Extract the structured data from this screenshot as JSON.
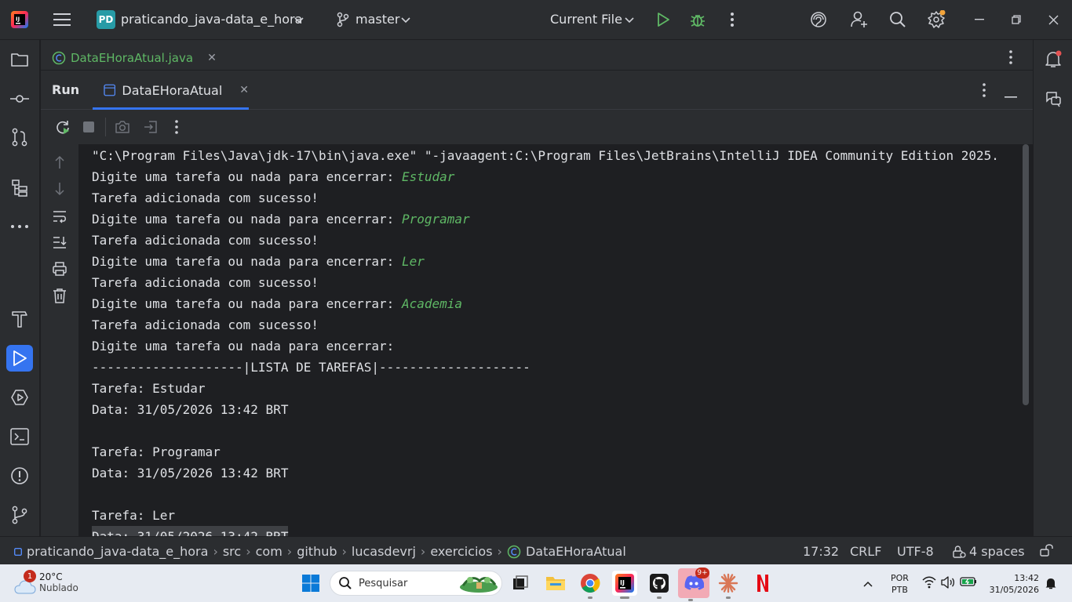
{
  "titlebar": {
    "project_badge": "PD",
    "project_name": "praticando_java-data_e_hora",
    "branch": "master",
    "run_config": "Current File"
  },
  "editor": {
    "tab_file": "DataEHoraAtual.java"
  },
  "run_panel": {
    "title": "Run",
    "tab_label": "DataEHoraAtual"
  },
  "console": {
    "lines": [
      {
        "text": "\"C:\\Program Files\\Java\\jdk-17\\bin\\java.exe\" \"-javaagent:C:\\Program Files\\JetBrains\\IntelliJ IDEA Community Edition 2025.",
        "input": ""
      },
      {
        "text": "Digite uma tarefa ou nada para encerrar: ",
        "input": "Estudar"
      },
      {
        "text": "Tarefa adicionada com sucesso!",
        "input": ""
      },
      {
        "text": "Digite uma tarefa ou nada para encerrar: ",
        "input": "Programar"
      },
      {
        "text": "Tarefa adicionada com sucesso!",
        "input": ""
      },
      {
        "text": "Digite uma tarefa ou nada para encerrar: ",
        "input": "Ler"
      },
      {
        "text": "Tarefa adicionada com sucesso!",
        "input": ""
      },
      {
        "text": "Digite uma tarefa ou nada para encerrar: ",
        "input": "Academia"
      },
      {
        "text": "Tarefa adicionada com sucesso!",
        "input": ""
      },
      {
        "text": "Digite uma tarefa ou nada para encerrar:",
        "input": ""
      },
      {
        "text": "--------------------|LISTA DE TAREFAS|--------------------",
        "input": ""
      },
      {
        "text": "Tarefa: Estudar",
        "input": ""
      },
      {
        "text": "Data: 31/05/2026 13:42 BRT",
        "input": ""
      },
      {
        "text": "",
        "input": ""
      },
      {
        "text": "Tarefa: Programar",
        "input": ""
      },
      {
        "text": "Data: 31/05/2026 13:42 BRT",
        "input": ""
      },
      {
        "text": "",
        "input": ""
      },
      {
        "text": "Tarefa: Ler",
        "input": ""
      },
      {
        "text": "Data: 31/05/2026 13:42 BRT",
        "input": ""
      }
    ]
  },
  "statusbar": {
    "breadcrumbs": [
      "praticando_java-data_e_hora",
      "src",
      "com",
      "github",
      "lucasdevrj",
      "exercicios",
      "DataEHoraAtual"
    ],
    "position": "17:32",
    "line_ending": "CRLF",
    "encoding": "UTF-8",
    "indent": "4 spaces"
  },
  "taskbar": {
    "weather_temp": "20°C",
    "weather_desc": "Nublado",
    "weather_badge": "1",
    "search_placeholder": "Pesquisar",
    "discord_badge": "9+",
    "lang_1": "POR",
    "lang_2": "PTB",
    "time": "13:42",
    "date": "31/05/2026"
  },
  "colors": {
    "accent": "#3574f0",
    "input_text": "#5fb865",
    "panel_bg": "#2b2d30",
    "console_bg": "#1e1f22"
  }
}
